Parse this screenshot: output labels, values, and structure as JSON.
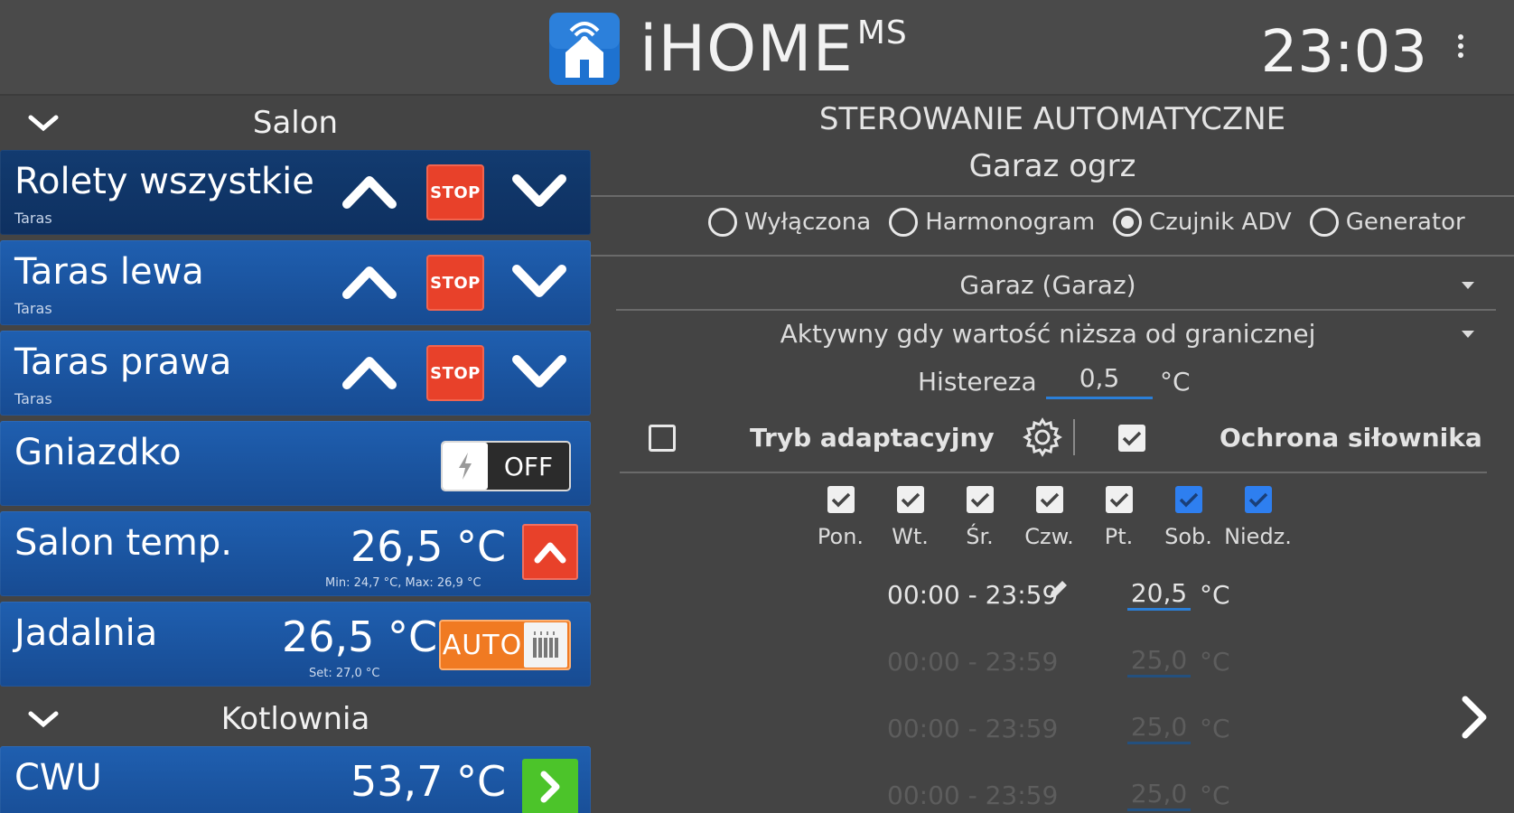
{
  "header": {
    "brand": "iHOME",
    "brand_suffix": "MS",
    "time": "23:03",
    "icons": {
      "logo": "ihome-house-wifi-icon",
      "menu": "kebab-menu-icon"
    },
    "colors": {
      "logo_blue": "#1e72d0"
    }
  },
  "left": {
    "sections": [
      {
        "title": "Salon"
      },
      {
        "title": "Kotlownia"
      }
    ],
    "tiles": [
      {
        "name": "Rolety wszystkie",
        "sub": "Taras",
        "stop_label": "STOP"
      },
      {
        "name": "Taras lewa",
        "sub": "Taras",
        "stop_label": "STOP"
      },
      {
        "name": "Taras prawa",
        "sub": "Taras",
        "stop_label": "STOP"
      },
      {
        "name": "Gniazdko",
        "state": "OFF"
      },
      {
        "name": "Salon temp.",
        "value": "26,5 °C",
        "meta": "Min: 24,7 °C, Max: 26,9 °C"
      },
      {
        "name": "Jadalnia",
        "value": "26,5 °C",
        "meta": "Set: 27,0 °C",
        "mode": "AUTO"
      },
      {
        "name": "CWU",
        "value": "53,7 °C"
      }
    ],
    "colors": {
      "tile_blue": "#1f5fb0",
      "stop_red": "#e8412a",
      "auto_orange": "#f07a22",
      "go_green": "#4cc42a"
    }
  },
  "right": {
    "heading": "STEROWANIE AUTOMATYCZNE",
    "subheading": "Garaz ogrz",
    "modes": [
      {
        "label": "Wyłączona",
        "selected": false
      },
      {
        "label": "Harmonogram",
        "selected": false
      },
      {
        "label": "Czujnik ADV",
        "selected": true
      },
      {
        "label": "Generator",
        "selected": false
      }
    ],
    "sensor_select": "Garaz (Garaz)",
    "condition_select": "Aktywny gdy wartość niższa od granicznej",
    "hysteresis": {
      "label": "Histereza",
      "value": "0,5",
      "unit": "°C"
    },
    "adaptive": {
      "label": "Tryb adaptacyjny",
      "checked": false
    },
    "actuator": {
      "label": "Ochrona siłownika",
      "checked": true
    },
    "days": [
      {
        "label": "Pon.",
        "checked": true,
        "style": "white"
      },
      {
        "label": "Wt.",
        "checked": true,
        "style": "white"
      },
      {
        "label": "Śr.",
        "checked": true,
        "style": "white"
      },
      {
        "label": "Czw.",
        "checked": true,
        "style": "white"
      },
      {
        "label": "Pt.",
        "checked": true,
        "style": "white"
      },
      {
        "label": "Sob.",
        "checked": true,
        "style": "blue"
      },
      {
        "label": "Niedz.",
        "checked": true,
        "style": "blue"
      }
    ],
    "schedule": [
      {
        "range": "00:00 - 23:59",
        "value": "20,5",
        "unit": "°C",
        "active": true
      },
      {
        "range": "00:00 - 23:59",
        "value": "25,0",
        "unit": "°C",
        "active": false
      },
      {
        "range": "00:00 - 23:59",
        "value": "25,0",
        "unit": "°C",
        "active": false
      },
      {
        "range": "00:00 - 23:59",
        "value": "25,0",
        "unit": "°C",
        "active": false
      }
    ],
    "colors": {
      "underline_blue": "#2b7fd8",
      "checkbox_blue": "#2e7ff0"
    }
  }
}
